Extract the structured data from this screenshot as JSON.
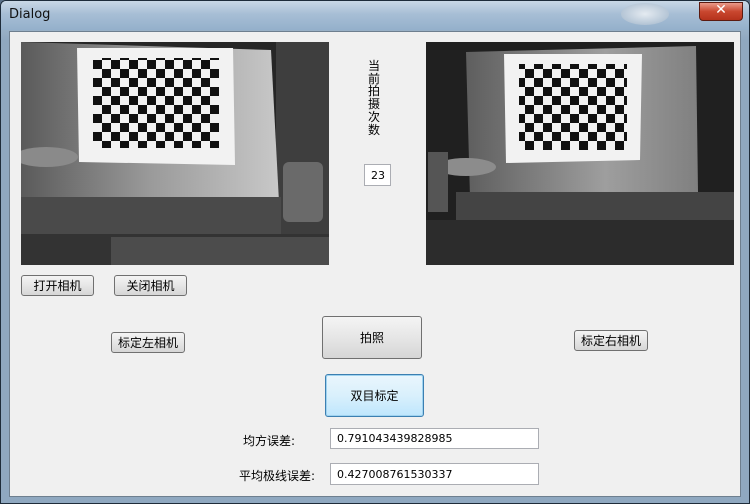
{
  "window": {
    "title": "Dialog"
  },
  "vertical_label": "当前拍摄次数",
  "shot_count": "23",
  "buttons": {
    "open_camera": "打开相机",
    "close_camera": "关闭相机",
    "calibrate_left": "标定左相机",
    "capture": "拍照",
    "calibrate_right": "标定右相机",
    "stereo_calibrate": "双目标定"
  },
  "results": {
    "rms_error_label": "均方误差:",
    "rms_error_value": "0.791043439828985",
    "epipolar_error_label": "平均极线误差:",
    "epipolar_error_value": "0.427008761530337"
  },
  "icons": {
    "close": "close-icon"
  }
}
